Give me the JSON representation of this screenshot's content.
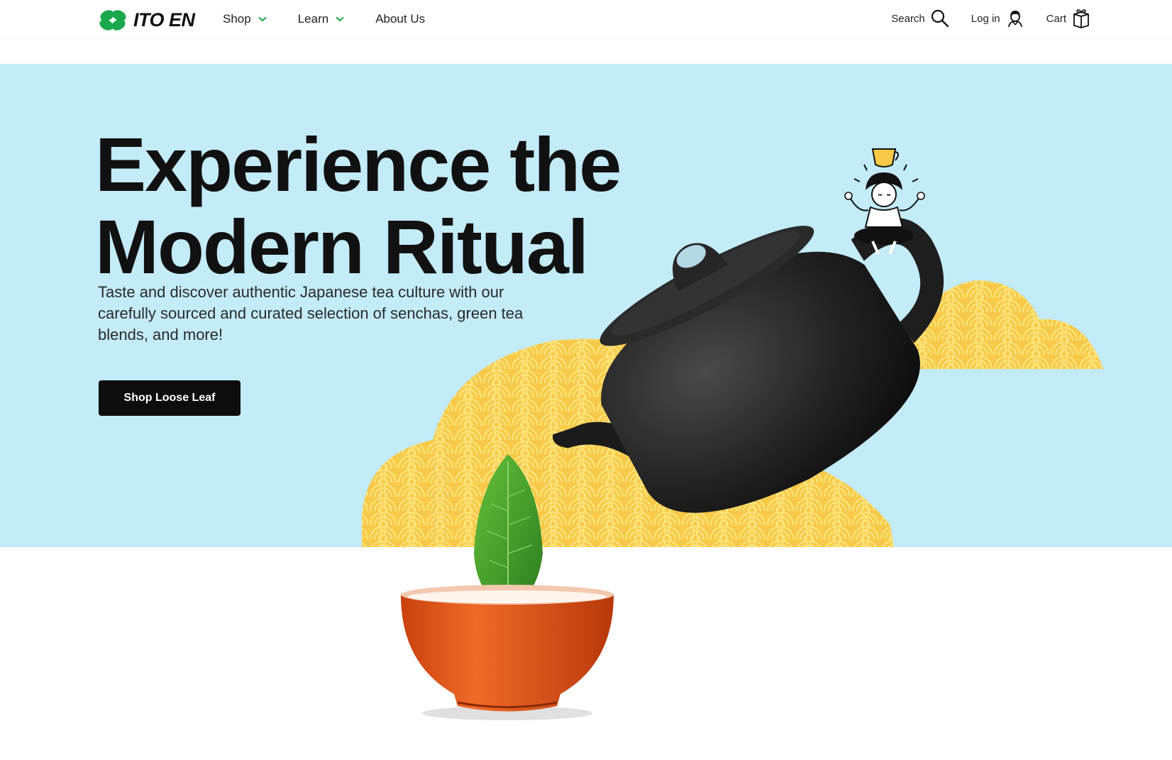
{
  "header": {
    "logo_text": "ITO EN",
    "nav": [
      {
        "label": "Shop",
        "has_dropdown": true
      },
      {
        "label": "Learn",
        "has_dropdown": true
      },
      {
        "label": "About Us",
        "has_dropdown": false
      }
    ],
    "utility": {
      "search_label": "Search",
      "login_label": "Log in",
      "cart_label": "Cart"
    },
    "icons": {
      "logo": "clover-logo-icon",
      "dropdown": "chevron-down-icon",
      "search": "search-icon",
      "login": "user-icon",
      "cart": "gift-box-icon"
    }
  },
  "hero": {
    "headline_line1": "Experience the",
    "headline_line2": "Modern Ritual",
    "subcopy": "Taste and discover authentic Japanese tea culture with our carefully sourced and curated selection of senchas, green tea blends, and more!",
    "cta_label": "Shop Loose Leaf"
  },
  "colors": {
    "brand_green": "#1aa84a",
    "hero_background": "#c3ebf8",
    "wave_yellow": "#f7c948",
    "wave_light": "#fbe37a",
    "teapot": "#1c1c1c",
    "bowl_orange": "#e0521a",
    "leaf_green": "#3a9a2a",
    "cta_background": "#0d0d0d"
  }
}
